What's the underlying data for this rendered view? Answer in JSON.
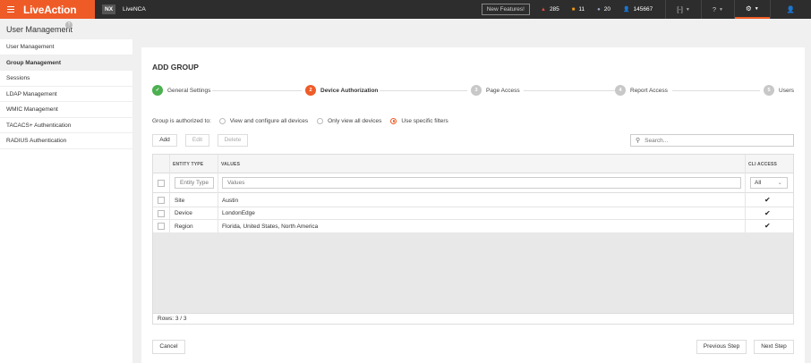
{
  "topbar": {
    "brand": "LiveAction",
    "badge": "NX",
    "app_name": "LiveNCA",
    "new_features": "New Features!",
    "stats": [
      {
        "icon": "warning-triangle-icon",
        "color": "#e74c3c",
        "value": "285"
      },
      {
        "icon": "square-alert-icon",
        "color": "#f39c12",
        "value": "11"
      },
      {
        "icon": "circle-info-icon",
        "color": "#9aa8c7",
        "value": "20"
      },
      {
        "icon": "user-group-icon",
        "color": "#7aa7e0",
        "value": "145667"
      }
    ],
    "bracket_icon": "[-]"
  },
  "page": {
    "title": "User Management"
  },
  "sidebar": {
    "items": [
      {
        "label": "User Management"
      },
      {
        "label": "Group Management"
      },
      {
        "label": "Sessions"
      },
      {
        "label": "LDAP Management"
      },
      {
        "label": "WMIC Management"
      },
      {
        "label": "TACACS+ Authentication"
      },
      {
        "label": "RADIUS Authentication"
      }
    ],
    "active_index": 1
  },
  "panel": {
    "title": "ADD GROUP"
  },
  "steps": [
    {
      "num": "✓",
      "label": "General Settings",
      "state": "done"
    },
    {
      "num": "2",
      "label": "Device Authorization",
      "state": "current"
    },
    {
      "num": "3",
      "label": "Page Access",
      "state": "pending"
    },
    {
      "num": "4",
      "label": "Report Access",
      "state": "pending"
    },
    {
      "num": "5",
      "label": "Users",
      "state": "pending"
    }
  ],
  "colors": {
    "accent": "#ef5b27",
    "done": "#4caf50",
    "pending": "#c8c8c8"
  },
  "authorization": {
    "label": "Group is authorized to:",
    "options": [
      {
        "label": "View and configure all devices",
        "selected": false
      },
      {
        "label": "Only view all devices",
        "selected": false
      },
      {
        "label": "Use specific filters",
        "selected": true
      }
    ]
  },
  "toolbar": {
    "add": "Add",
    "edit": "Edit",
    "delete": "Delete",
    "search_placeholder": "Search..."
  },
  "grid": {
    "columns": {
      "entity_type": "ENTITY TYPE",
      "values": "VALUES",
      "cli_access": "CLI ACCESS"
    },
    "filters": {
      "entity_type_placeholder": "Entity Type",
      "values_placeholder": "Values",
      "cli_access_value": "All"
    },
    "rows": [
      {
        "entity_type": "Site",
        "values": "Austin",
        "cli_access": true
      },
      {
        "entity_type": "Device",
        "values": "LondonEdge",
        "cli_access": true
      },
      {
        "entity_type": "Region",
        "values": "Florida, United States, North America",
        "cli_access": true
      }
    ],
    "rows_label": "Rows: 3 / 3"
  },
  "footer": {
    "cancel": "Cancel",
    "previous": "Previous Step",
    "next": "Next Step"
  }
}
